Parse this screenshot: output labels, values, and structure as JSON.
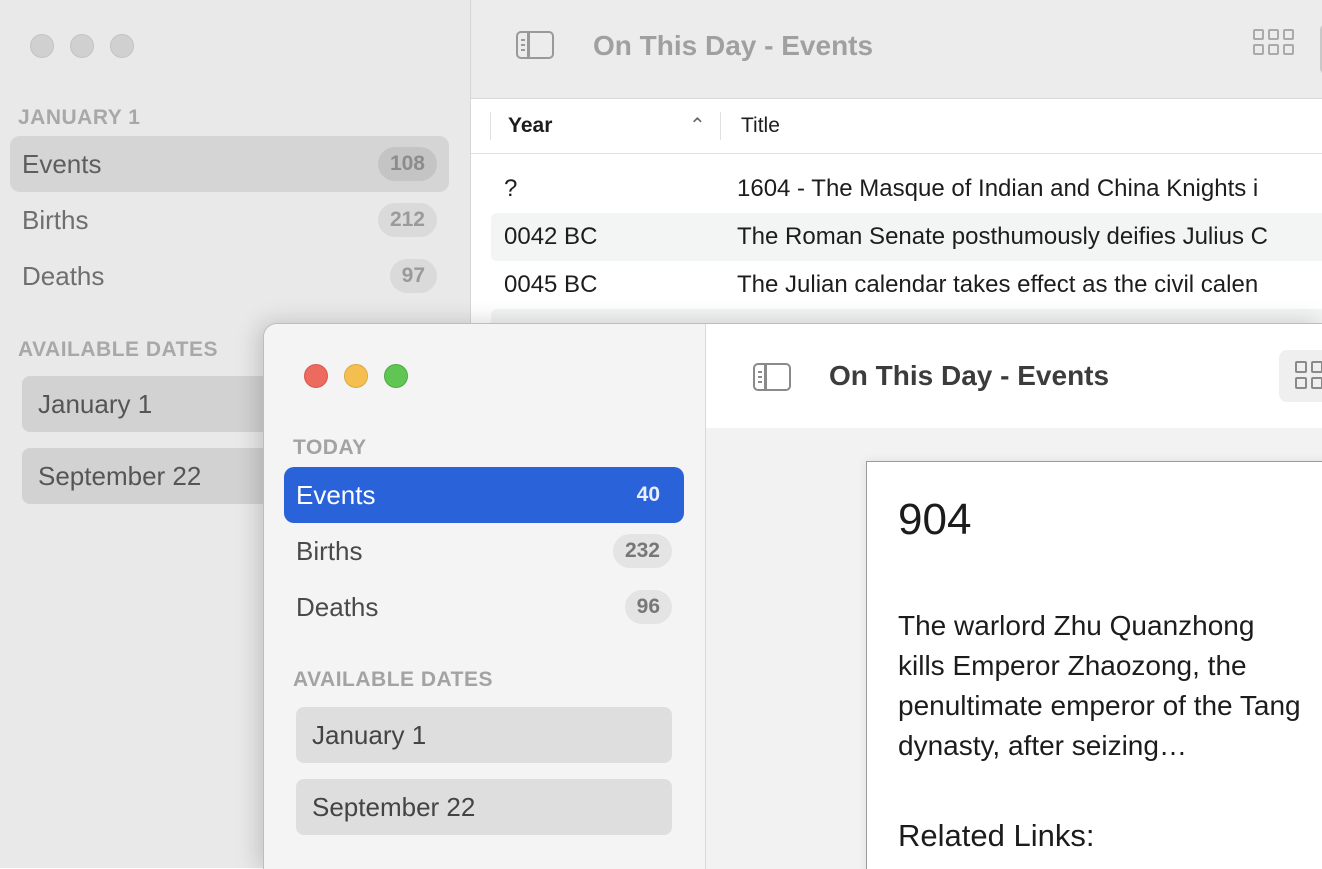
{
  "back_window": {
    "title": "On This Day - Events",
    "sidebar": {
      "section_date": "JANUARY 1",
      "items": [
        {
          "label": "Events",
          "count": "108"
        },
        {
          "label": "Births",
          "count": "212"
        },
        {
          "label": "Deaths",
          "count": "97"
        }
      ],
      "section_available": "AVAILABLE DATES",
      "dates": [
        "January 1",
        "September 22"
      ]
    },
    "table": {
      "columns": [
        "Year",
        "Title"
      ],
      "sort_indicator": "^",
      "rows": [
        {
          "year": "?",
          "title": "1604 - The Masque of Indian and China Knights i"
        },
        {
          "year": "0042 BC",
          "title": "The Roman Senate posthumously deifies Julius C"
        },
        {
          "year": "0045 BC",
          "title": "The Julian calendar takes effect as the civil calen"
        }
      ]
    }
  },
  "front_window": {
    "title": "On This Day - Events",
    "sidebar": {
      "section_date": "TODAY",
      "items": [
        {
          "label": "Events",
          "count": "40"
        },
        {
          "label": "Births",
          "count": "232"
        },
        {
          "label": "Deaths",
          "count": "96"
        }
      ],
      "section_available": "AVAILABLE DATES",
      "dates": [
        "January 1",
        "September 22"
      ]
    },
    "detail": {
      "year": "904",
      "text": "The warlord Zhu Quanzhong kills Emperor Zhaozong, the penultimate emperor of the Tang dynasty, after seizing…",
      "links_heading": "Related Links:"
    }
  },
  "colors": {
    "accent": "#2a63d9",
    "close": "#ed6a5e",
    "minimize": "#f4bf4f",
    "zoom": "#61c554"
  },
  "icons": [
    "sidebar-toggle-icon",
    "grid-view-icon",
    "sort-ascending-icon"
  ]
}
